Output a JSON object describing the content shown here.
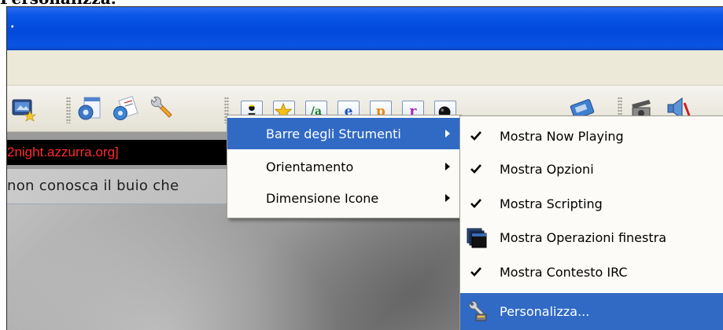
{
  "page": {
    "caption": "Personalizza."
  },
  "window": {
    "title": "."
  },
  "toolbar": {
    "icons": [
      "screen-star-icon",
      "gear-window-icon",
      "gear-config-icon",
      "wrench-icon",
      "app-launch-icon",
      "favorites-star-icon",
      "text-a-icon",
      "e-icon",
      "p-icon",
      "r-icon",
      "dark-ball-icon",
      "tape-icon",
      "camera-icon",
      "speaker-icon"
    ],
    "app_letters": {
      "a": "/a",
      "e": "e",
      "p": "p",
      "r": "r"
    }
  },
  "chat": {
    "channel_text": "2night.azzurra.org]",
    "topic_text": "non conosca il buio che"
  },
  "context_menu": {
    "items": [
      {
        "label": "Barre degli Strumenti",
        "has_submenu": true,
        "highlighted": true
      },
      {
        "label": "Orientamento",
        "has_submenu": true,
        "highlighted": false
      },
      {
        "label": "Dimensione Icone",
        "has_submenu": true,
        "highlighted": false
      }
    ]
  },
  "submenu": {
    "items": [
      {
        "label": "Mostra Now Playing",
        "checked": true
      },
      {
        "label": "Mostra Opzioni",
        "checked": true
      },
      {
        "label": "Mostra Scripting",
        "checked": true
      },
      {
        "label": "Mostra Operazioni finestra",
        "icon": "stacked-windows-icon"
      },
      {
        "label": "Mostra Contesto IRC",
        "checked": true
      },
      {
        "label": "Personalizza...",
        "icon": "customize-wrench-icon",
        "highlighted": true
      }
    ]
  },
  "colors": {
    "selection": "#316ac5",
    "titlebar": "#0148dc",
    "channel_text": "#ff2a2a"
  }
}
